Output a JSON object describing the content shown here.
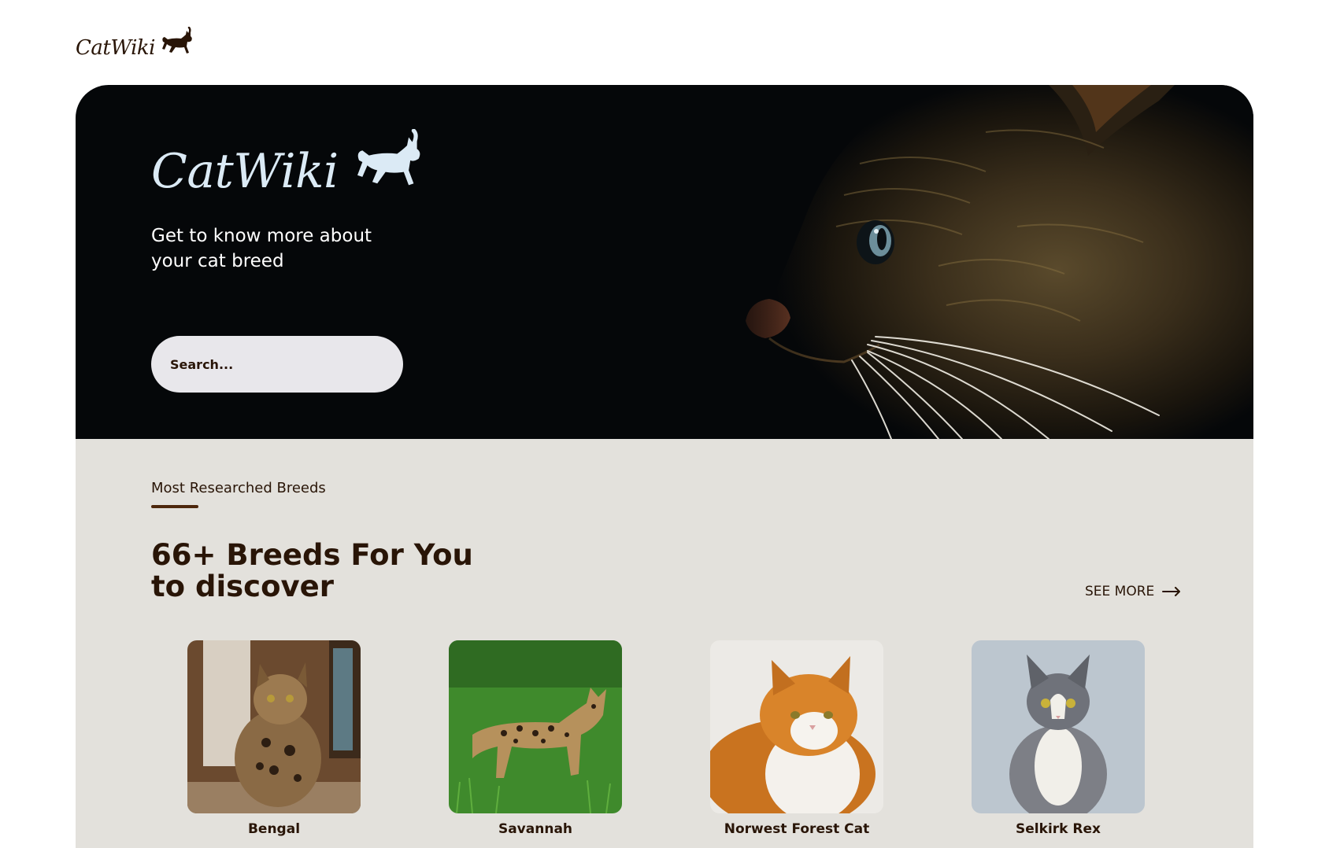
{
  "header": {
    "logo_text": "CatWiki",
    "logo_icon": "cat-silhouette-icon"
  },
  "hero": {
    "logo_text": "CatWiki",
    "logo_icon": "cat-silhouette-icon",
    "tagline": "Get to know more about your cat breed",
    "search": {
      "placeholder": "Search...",
      "value": ""
    },
    "image": "cat-profile-closeup"
  },
  "breeds_section": {
    "label": "Most Researched Breeds",
    "heading": "66+ Breeds For You to discover",
    "see_more": "SEE MORE",
    "see_more_icon": "arrow-right-icon",
    "items": [
      {
        "name": "Bengal"
      },
      {
        "name": "Savannah"
      },
      {
        "name": "Norwest Forest Cat"
      },
      {
        "name": "Selkirk Rex"
      }
    ]
  },
  "colors": {
    "brand_dark": "#291507",
    "hero_bg": "#050709",
    "hero_logo": "#dbeaf5",
    "section_bg": "#e3e1dc",
    "search_bg": "#e8e7eb",
    "underline": "#4d270c"
  }
}
